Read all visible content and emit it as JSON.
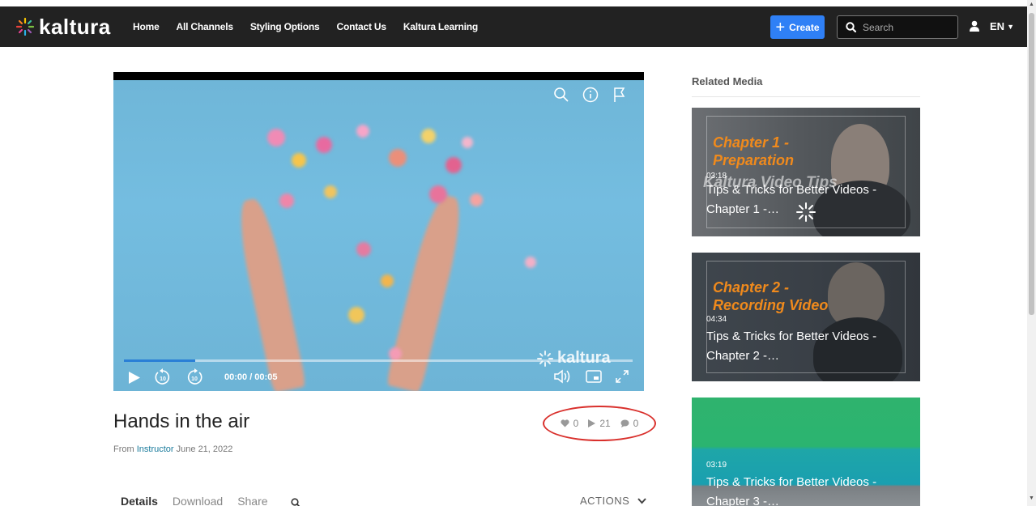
{
  "brand": {
    "name": "kaltura"
  },
  "nav": {
    "items": [
      "Home",
      "All Channels",
      "Styling Options",
      "Contact Us",
      "Kaltura Learning"
    ]
  },
  "header": {
    "create_label": "Create",
    "search_placeholder": "Search",
    "language": "EN"
  },
  "player": {
    "time": "00:00 / 00:05",
    "progress": 0.14,
    "watermark": "kaltura"
  },
  "media": {
    "title": "Hands in the air",
    "from_label": "From",
    "author": "Instructor",
    "date": "June 21, 2022",
    "likes": "0",
    "plays": "21",
    "comments": "0"
  },
  "tabs": [
    "Details",
    "Download",
    "Share"
  ],
  "actions_label": "ACTIONS",
  "related": {
    "heading": "Related Media",
    "items": [
      {
        "chapter": "Chapter 1 -",
        "chapter2": "Preparation",
        "overlay": "Kaltura Video Tips",
        "duration": "03:18",
        "title": "Tips & Tricks for Better Videos -",
        "title2": "Chapter 1 -…"
      },
      {
        "chapter": "Chapter 2 -",
        "chapter2": "Recording Video",
        "duration": "04:34",
        "title": "Tips & Tricks for Better Videos -",
        "title2": "Chapter 2 -…"
      },
      {
        "duration": "03:19",
        "title": "Tips & Tricks for Better Videos -",
        "title2": "Chapter 3 -…"
      }
    ]
  },
  "colors": {
    "topbar": "#222222",
    "accent": "#2f80f6",
    "link": "#1a7b9c",
    "chapter_orange": "#f08a1c",
    "highlight_ring": "#d9302c"
  }
}
